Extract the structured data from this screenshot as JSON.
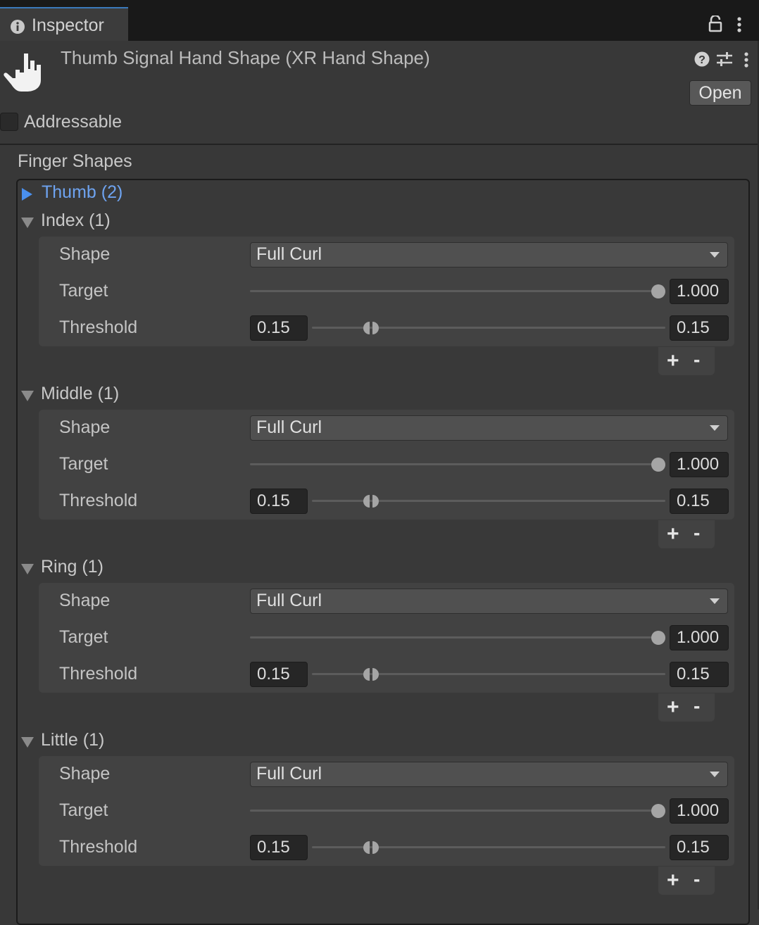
{
  "tab": {
    "label": "Inspector",
    "icon": "info-icon"
  },
  "header": {
    "title": "Thumb Signal Hand Shape (XR Hand Shape)",
    "open_label": "Open",
    "icons": [
      "hand-icon",
      "help-icon",
      "preset-icon",
      "kebab-menu-icon",
      "lock-icon"
    ]
  },
  "addressable": {
    "label": "Addressable",
    "checked": false
  },
  "section_title": "Finger Shapes",
  "thumb": {
    "label": "Thumb (2)",
    "expanded": false
  },
  "fingers": [
    {
      "label": "Index (1)",
      "shape_label": "Shape",
      "shape_value": "Full Curl",
      "target_label": "Target",
      "target_value": "1.000",
      "threshold_label": "Threshold",
      "threshold_min": "0.15",
      "threshold_max": "0.15"
    },
    {
      "label": "Middle (1)",
      "shape_label": "Shape",
      "shape_value": "Full Curl",
      "target_label": "Target",
      "target_value": "1.000",
      "threshold_label": "Threshold",
      "threshold_min": "0.15",
      "threshold_max": "0.15"
    },
    {
      "label": "Ring (1)",
      "shape_label": "Shape",
      "shape_value": "Full Curl",
      "target_label": "Target",
      "target_value": "1.000",
      "threshold_label": "Threshold",
      "threshold_min": "0.15",
      "threshold_max": "0.15"
    },
    {
      "label": "Little (1)",
      "shape_label": "Shape",
      "shape_value": "Full Curl",
      "target_label": "Target",
      "target_value": "1.000",
      "threshold_label": "Threshold",
      "threshold_min": "0.15",
      "threshold_max": "0.15"
    }
  ],
  "list_controls": {
    "add": "+",
    "remove": "-"
  },
  "colors": {
    "background": "#383838",
    "tabbar": "#191919",
    "accent": "#3a79bb",
    "foldout_link": "#6ea3f0"
  }
}
